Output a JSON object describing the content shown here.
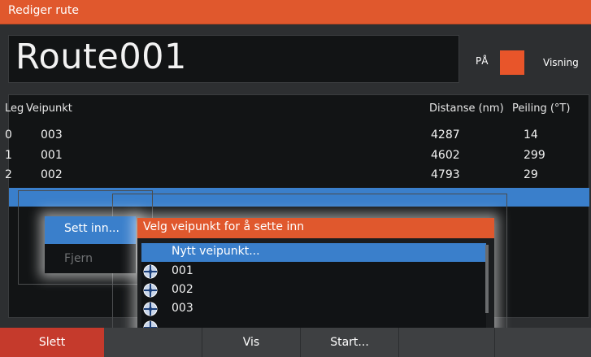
{
  "window": {
    "title": "Rediger rute"
  },
  "route": {
    "name": "Route001",
    "toggle_label": "PÅ",
    "view_label": "Visning"
  },
  "table": {
    "headers": {
      "leg": "Leg",
      "waypoint": "Veipunkt",
      "distance": "Distanse (nm)",
      "bearing": "Peiling (°T)"
    },
    "rows": [
      {
        "leg": "0",
        "waypoint": "003",
        "distance": "4287",
        "bearing": "14"
      },
      {
        "leg": "1",
        "waypoint": "001",
        "distance": "4602",
        "bearing": "299"
      },
      {
        "leg": "2",
        "waypoint": "002",
        "distance": "4793",
        "bearing": "29"
      }
    ]
  },
  "context_menu": {
    "insert_label": "Sett inn...",
    "remove_label": "Fjern"
  },
  "submenu": {
    "title": "Velg veipunkt for å sette inn",
    "new_waypoint": "Nytt veipunkt...",
    "waypoints": [
      "001",
      "002",
      "003"
    ]
  },
  "bottom_bar": {
    "delete_label": "Slett",
    "show_label": "Vis",
    "start_label": "Start..."
  },
  "colors": {
    "accent": "#e0582d",
    "selection": "#3a7fcb",
    "danger": "#c53a2c"
  }
}
